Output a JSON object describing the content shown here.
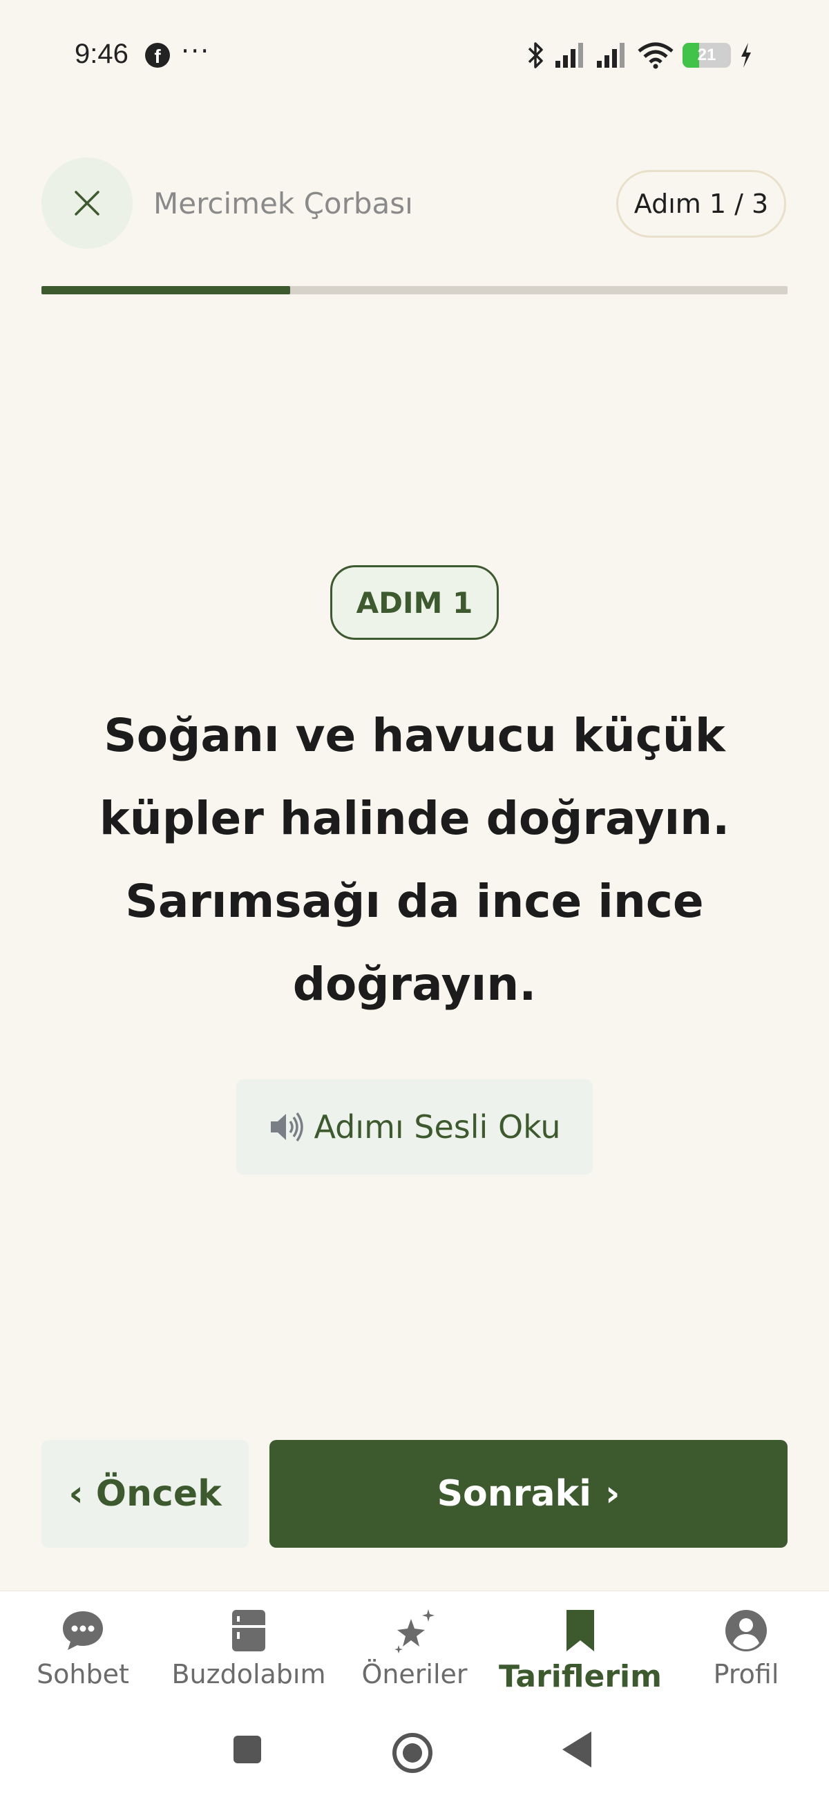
{
  "status_bar": {
    "time": "9:46",
    "facebook_glyph": "f",
    "more_dots": "···",
    "battery_level": "21",
    "icons": [
      "bluetooth-icon",
      "signal-icon",
      "signal-icon",
      "wifi-icon",
      "battery-icon",
      "charging-icon"
    ]
  },
  "header": {
    "recipe_title": "Mercimek Çorbası",
    "step_badge": "Adım 1 / 3",
    "progress_fraction": 0.333
  },
  "step": {
    "label": "ADIM 1",
    "text": "Soğanı ve havucu küçük küpler halinde doğrayın. Sarımsağı da ince ince doğrayın.",
    "read_aloud_label": "Adımı Sesli Oku"
  },
  "navigation": {
    "prev_chevron": "‹",
    "prev_label": "Öncek",
    "next_label": "Sonraki",
    "next_chevron": "›"
  },
  "tabs": [
    {
      "label": "Sohbet",
      "icon": "chat-bubble-icon",
      "active": false
    },
    {
      "label": "Buzdolabım",
      "icon": "fridge-icon",
      "active": false
    },
    {
      "label": "Öneriler",
      "icon": "sparkle-stars-icon",
      "active": false
    },
    {
      "label": "Tariflerim",
      "icon": "bookmark-icon",
      "active": true
    },
    {
      "label": "Profil",
      "icon": "profile-icon",
      "active": false
    }
  ],
  "colors": {
    "primary": "#3d5a2e",
    "background": "#f9f6f0",
    "light_green": "#eef2ec",
    "badge_border": "#e8e0c8"
  }
}
